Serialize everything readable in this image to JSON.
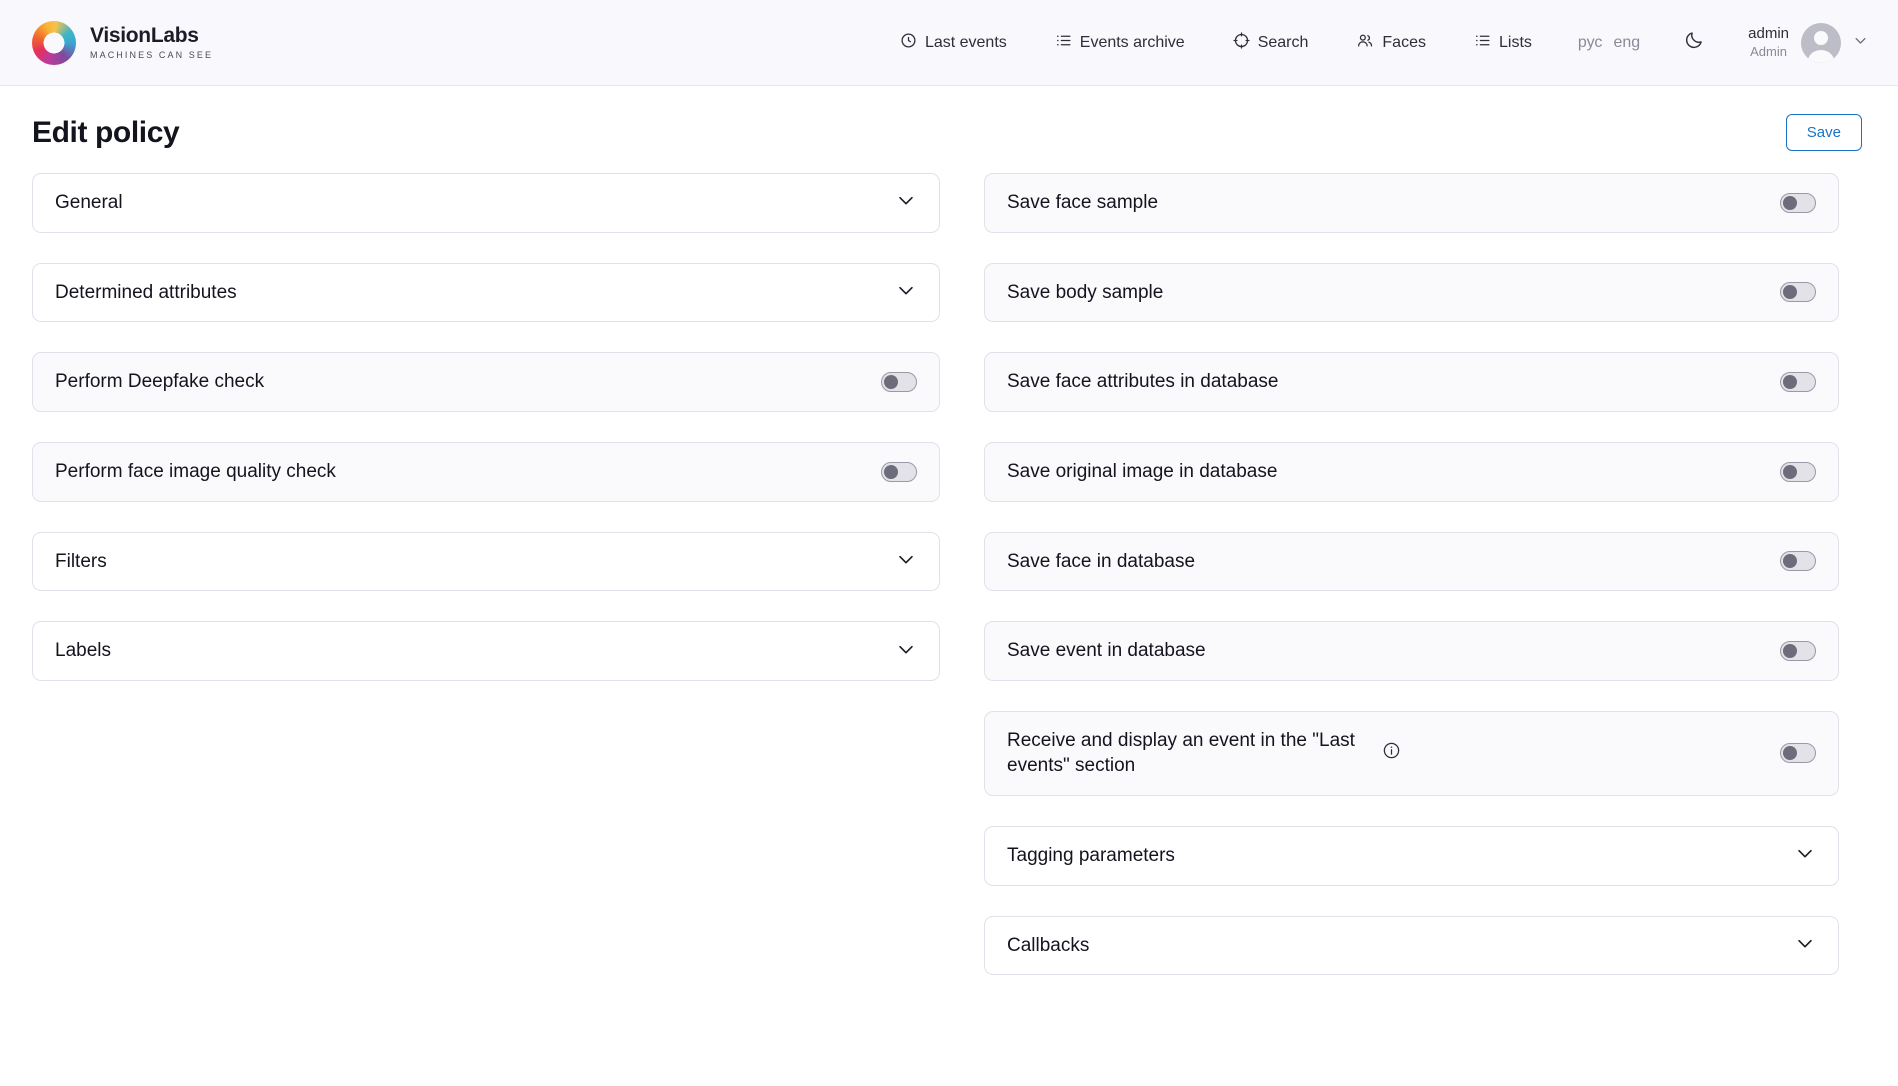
{
  "brand": {
    "name": "VisionLabs",
    "tagline": "MACHINES CAN SEE",
    "logo_icon": "visionlabs-ring-logo"
  },
  "nav": {
    "items": [
      {
        "label": "Last events",
        "icon": "clock-icon"
      },
      {
        "label": "Events archive",
        "icon": "list-icon"
      },
      {
        "label": "Search",
        "icon": "target-icon"
      },
      {
        "label": "Faces",
        "icon": "people-icon"
      },
      {
        "label": "Lists",
        "icon": "list-icon"
      }
    ],
    "lang": {
      "ru": "рус",
      "en": "eng"
    },
    "theme_icon": "moon-icon",
    "user": {
      "login": "admin",
      "role": "Admin",
      "chevron": "chevron-down-icon"
    }
  },
  "page": {
    "title": "Edit policy",
    "save_label": "Save"
  },
  "left_column": [
    {
      "label": "General",
      "type": "section"
    },
    {
      "label": "Determined attributes",
      "type": "section"
    },
    {
      "label": "Perform Deepfake check",
      "type": "toggle",
      "checked": false
    },
    {
      "label": "Perform face image quality check",
      "type": "toggle",
      "checked": false
    },
    {
      "label": "Filters",
      "type": "section"
    },
    {
      "label": "Labels",
      "type": "section"
    }
  ],
  "right_column": [
    {
      "label": "Save face sample",
      "type": "toggle",
      "checked": false
    },
    {
      "label": "Save body sample",
      "type": "toggle",
      "checked": false
    },
    {
      "label": "Save face attributes in database",
      "type": "toggle",
      "checked": false
    },
    {
      "label": "Save original image in database",
      "type": "toggle",
      "checked": false
    },
    {
      "label": "Save face in database",
      "type": "toggle",
      "checked": false
    },
    {
      "label": "Save event in database",
      "type": "toggle",
      "checked": false
    },
    {
      "label": "Receive and display an event in the \"Last events\" section",
      "type": "toggle-info",
      "checked": false,
      "info_icon": "info-icon"
    },
    {
      "label": "Tagging parameters",
      "type": "section"
    },
    {
      "label": "Callbacks",
      "type": "section"
    }
  ],
  "colors": {
    "accent": "#1a73c7",
    "header_bg": "#f9f8fc",
    "card_border": "#e2e1ea",
    "toggle_card_bg": "#faf9fc",
    "switch_off_track": "#e3e2e8",
    "switch_off_knob": "#6d6c7a",
    "text": "#14141f",
    "muted_text": "#8a8a98"
  }
}
